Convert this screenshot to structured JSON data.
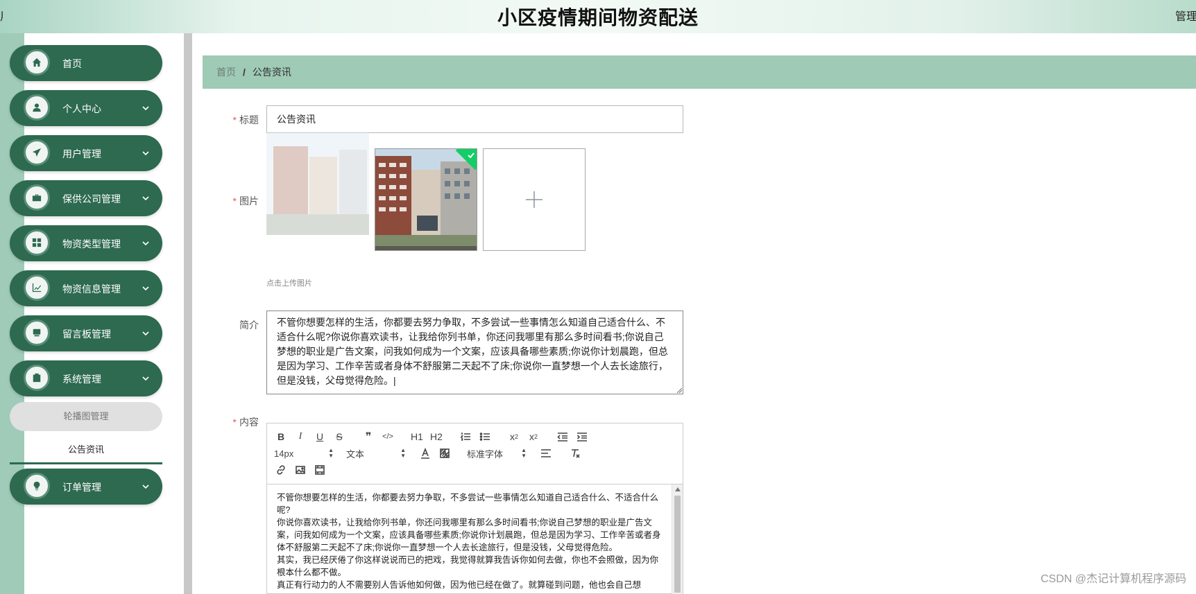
{
  "header": {
    "title": "小区疫情期间物资配送",
    "user_menu": "管理员",
    "left_mark": "用"
  },
  "sidebar": {
    "items": [
      {
        "label": "首页",
        "icon": "home-icon"
      },
      {
        "label": "个人中心",
        "icon": "user-icon"
      },
      {
        "label": "用户管理",
        "icon": "paper-plane-icon"
      },
      {
        "label": "保供公司管理",
        "icon": "briefcase-icon"
      },
      {
        "label": "物资类型管理",
        "icon": "grid-icon"
      },
      {
        "label": "物资信息管理",
        "icon": "chart-icon"
      },
      {
        "label": "留言板管理",
        "icon": "monitor-icon"
      },
      {
        "label": "系统管理",
        "icon": "clipboard-icon"
      },
      {
        "label": "订单管理",
        "icon": "bulb-icon"
      }
    ],
    "sub_items": [
      {
        "label": "轮播图管理"
      },
      {
        "label": "公告资讯"
      }
    ]
  },
  "breadcrumb": {
    "home": "首页",
    "separator": "/",
    "current": "公告资讯"
  },
  "form": {
    "title_label": "标题",
    "title_value": "公告资讯",
    "image_label": "图片",
    "upload_hint": "点击上传图片",
    "intro_label": "简介",
    "intro_value": "不管你想要怎样的生活，你都要去努力争取，不多尝试一些事情怎么知道自己适合什么、不适合什么呢?你说你喜欢读书，让我给你列书单，你还问我哪里有那么多时间看书;你说自己梦想的职业是广告文案，问我如何成为一个文案，应该具备哪些素质;你说你计划晨跑，但总是因为学习、工作辛苦或者身体不舒服第二天起不了床;你说你一直梦想一个人去长途旅行，但是没钱，父母觉得危险。|",
    "content_label": "内容",
    "required_mark": "*"
  },
  "editor": {
    "font_size": "14px",
    "block_type": "文本",
    "font_family": "标准字体",
    "toolbar_buttons": [
      "B",
      "I",
      "U",
      "S",
      "❞",
      "</>",
      "H1",
      "H2",
      "ol",
      "ul",
      "x2",
      "x2",
      "outdent",
      "indent"
    ],
    "paragraphs": [
      "不管你想要怎样的生活，你都要去努力争取，不多尝试一些事情怎么知道自己适合什么、不适合什么呢?",
      "你说你喜欢读书，让我给你列书单，你还问我哪里有那么多时间看书;你说自己梦想的职业是广告文案，问我如何成为一个文案，应该具备哪些素质;你说你计划晨跑，但总是因为学习、工作辛苦或者身体不舒服第二天起不了床;你说你一直梦想一个人去长途旅行，但是没钱，父母觉得危险。",
      "其实，我已经厌倦了你这样说说而已的把戏，我觉得就算我告诉你如何去做，你也不会照做，因为你根本什么都不做。",
      "真正有行动力的人不需要别人告诉他如何做，因为他已经在做了。就算碰到问题，他也会自己想"
    ]
  },
  "watermark": "CSDN @杰记计算机程序源码",
  "colors": {
    "nav_bg": "#2d6a50",
    "accent": "#9ecab6",
    "required": "#e05a5a"
  }
}
